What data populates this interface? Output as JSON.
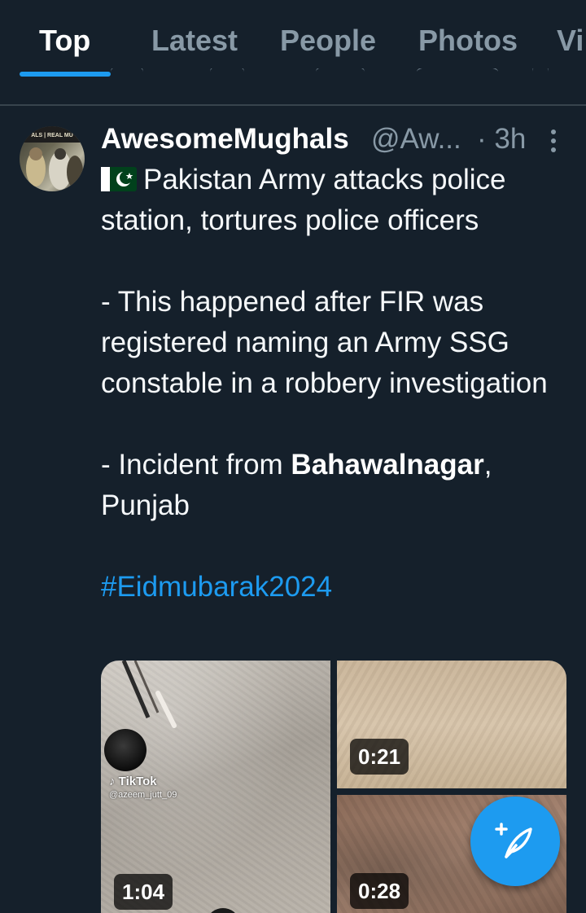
{
  "tabs": [
    {
      "label": "Top",
      "active": true
    },
    {
      "label": "Latest",
      "active": false
    },
    {
      "label": "People",
      "active": false
    },
    {
      "label": "Photos",
      "active": false
    },
    {
      "label": "Vi",
      "active": false
    }
  ],
  "tweet": {
    "author_name": "AwesomeMughals",
    "author_handle": "@Aw...",
    "time": "· 3h",
    "avatar_label": "REAL MUGHALS",
    "flag_icon": "pakistan-flag-icon",
    "headline": "Pakistan Army attacks police station, tortures police officers",
    "paragraph1": "- This happened after FIR was registered naming an Army SSG constable in a robbery investigation",
    "paragraph2_prefix": "- Incident from ",
    "paragraph2_bold": "Bahawalnagar",
    "paragraph2_suffix": ", Punjab",
    "hashtag": "#Eidmubarak2024",
    "media": [
      {
        "duration": "1:04",
        "watermark": "TikTok",
        "watermark_handle": "@azeem_jutt_09"
      },
      {
        "duration": "0:21"
      },
      {
        "duration": "0:28"
      }
    ]
  },
  "fab": {
    "icon": "compose-tweet-icon"
  },
  "colors": {
    "background": "#15202b",
    "accent": "#1d9bf0",
    "muted_text": "#8899a6",
    "divider": "#38444d"
  }
}
